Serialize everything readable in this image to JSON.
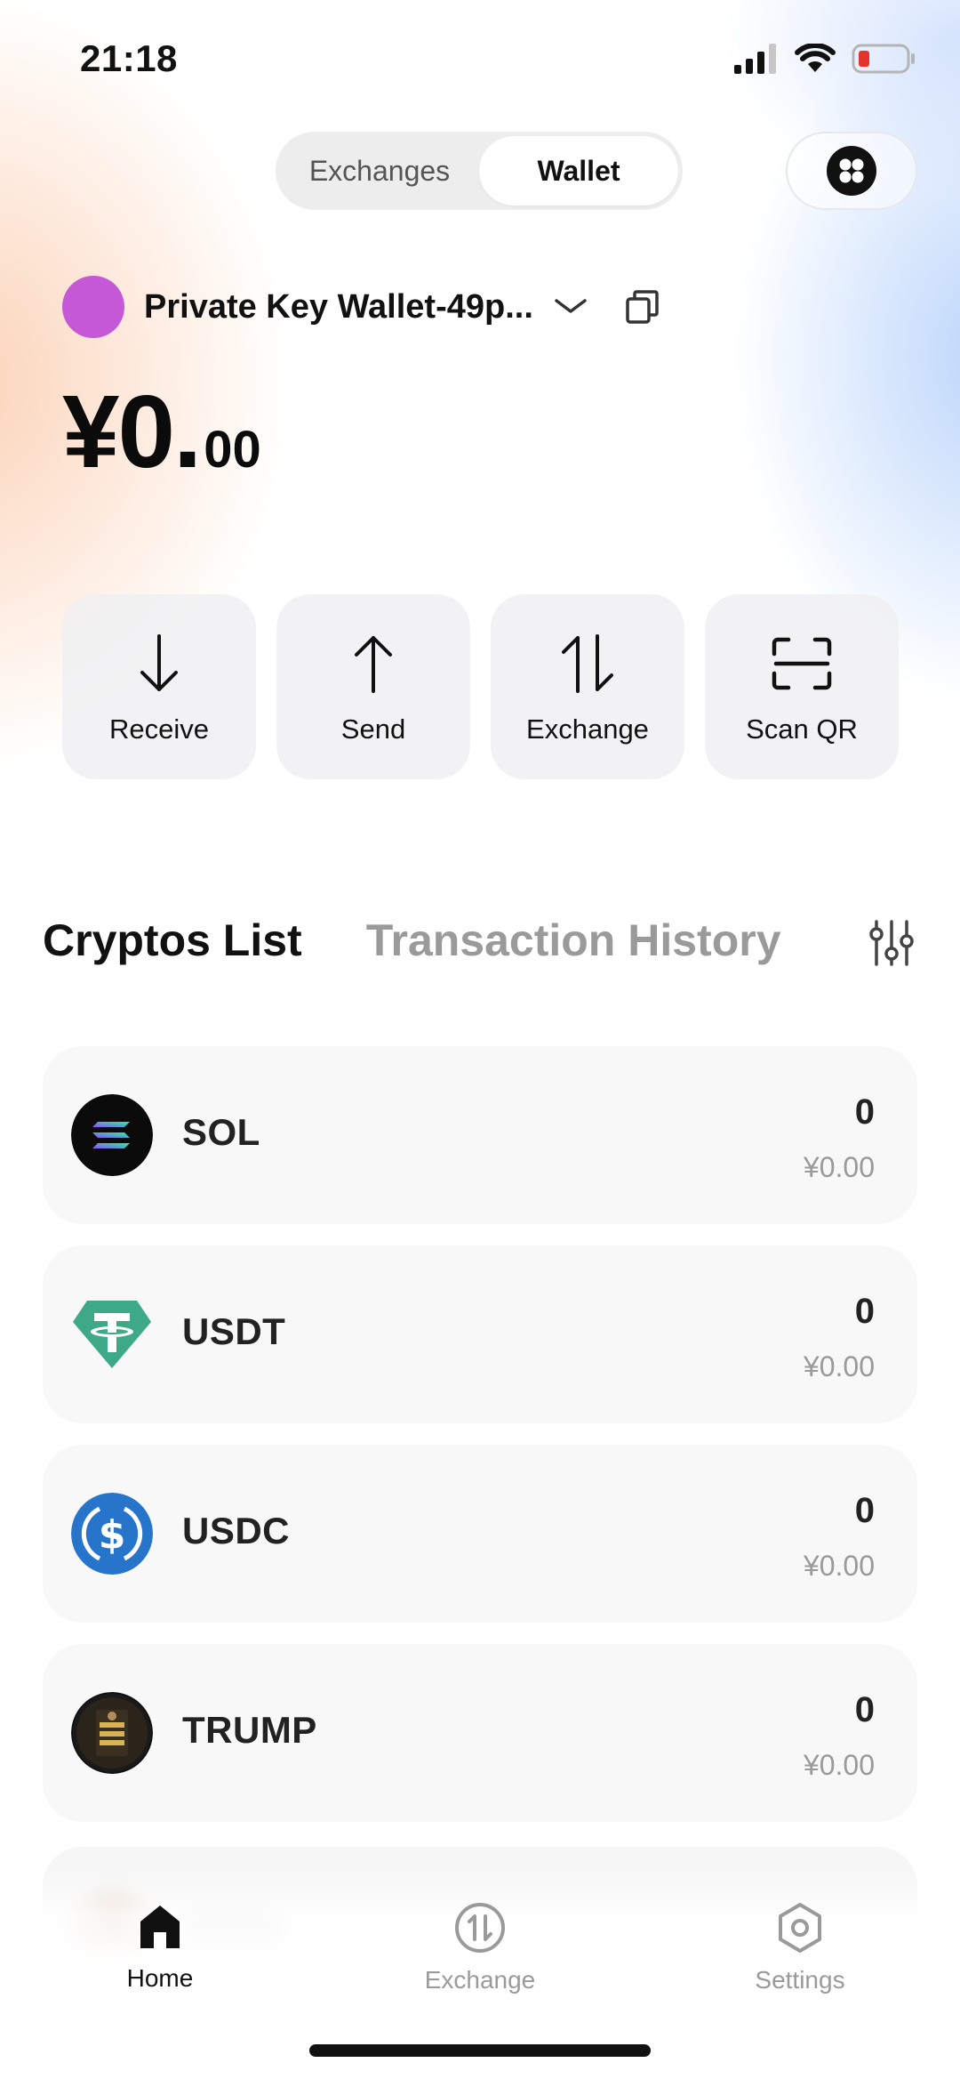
{
  "status_bar": {
    "time": "21:18",
    "battery_color": "#e5322d"
  },
  "header": {
    "tabs": [
      {
        "label": "Exchanges",
        "active": false
      },
      {
        "label": "Wallet",
        "active": true
      }
    ],
    "menu_icon": "four-dots-icon"
  },
  "wallet": {
    "name": "Private Key Wallet-49p...",
    "avatar_color": "#c458d6",
    "balance_main": "¥0.",
    "balance_decimal": "00"
  },
  "actions": [
    {
      "label": "Receive",
      "icon": "arrow-down-icon"
    },
    {
      "label": "Send",
      "icon": "arrow-up-icon"
    },
    {
      "label": "Exchange",
      "icon": "swap-vertical-icon"
    },
    {
      "label": "Scan QR",
      "icon": "scan-icon"
    }
  ],
  "list_tabs": {
    "active": "Cryptos List",
    "inactive": "Transaction History",
    "filter_icon": "sliders-icon"
  },
  "cryptos": [
    {
      "symbol": "SOL",
      "amount": "0",
      "value": "¥0.00"
    },
    {
      "symbol": "USDT",
      "amount": "0",
      "value": "¥0.00"
    },
    {
      "symbol": "USDC",
      "amount": "0",
      "value": "¥0.00"
    },
    {
      "symbol": "TRUMP",
      "amount": "0",
      "value": "¥0.00"
    }
  ],
  "bottom_nav": [
    {
      "label": "Home",
      "icon": "home-icon",
      "active": true
    },
    {
      "label": "Exchange",
      "icon": "exchange-icon",
      "active": false
    },
    {
      "label": "Settings",
      "icon": "settings-icon",
      "active": false
    }
  ]
}
